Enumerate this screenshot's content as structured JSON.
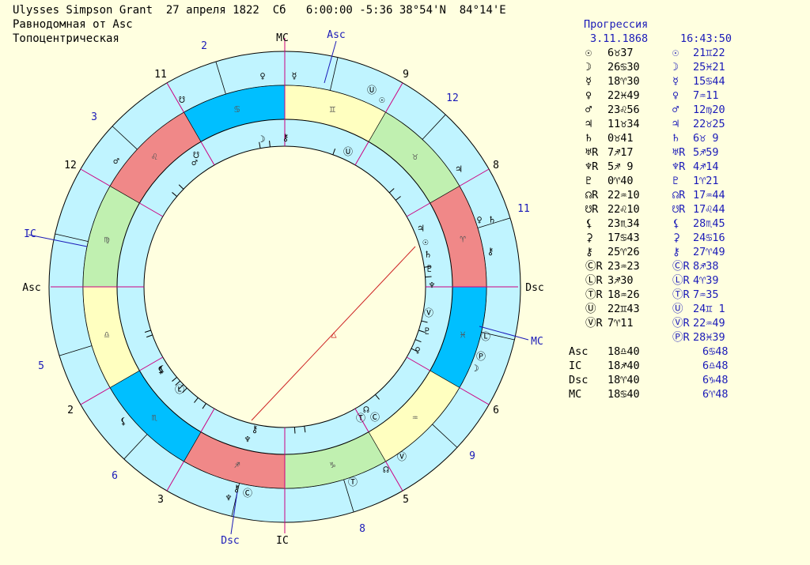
{
  "header": {
    "line1": "Ulysses Simpson Grant  27 апреля 1822  Сб   6:00:00 -5:36 38°54'N  84°14'E",
    "line2": "Равнодомная от Asc",
    "line3": "Топоцентрическая"
  },
  "progression": {
    "title": "Прогрессия",
    "date": "3.11.1868",
    "time": "16:43:50"
  },
  "planets": [
    {
      "glyph": "☉",
      "natal": "6♉37",
      "prog": "21♊22"
    },
    {
      "glyph": "☽",
      "natal": "26♋30",
      "prog": "25♓21"
    },
    {
      "glyph": "☿",
      "natal": "18♈30",
      "prog": "15♋44"
    },
    {
      "glyph": "♀",
      "natal": "22♓49",
      "prog": "7♒11"
    },
    {
      "glyph": "♂",
      "natal": "23♌56",
      "prog": "12♍20"
    },
    {
      "glyph": "♃",
      "natal": "11♉34",
      "prog": "22♉25"
    },
    {
      "glyph": "♄",
      "natal": "0♉41",
      "prog": "6♉ 9"
    },
    {
      "glyph": "♅",
      "r": "R",
      "natal": "7♐17",
      "prog": "5♐59"
    },
    {
      "glyph": "♆",
      "r": "R",
      "natal": "5♐ 9",
      "prog": "4♐14"
    },
    {
      "glyph": "♇",
      "natal": "0♈40",
      "prog": "1♈21"
    },
    {
      "glyph": "☊",
      "r": "R",
      "natal": "22♒10",
      "prog": "17♒44"
    },
    {
      "glyph": "☋",
      "r": "R",
      "natal": "22♌10",
      "prog": "17♌44"
    },
    {
      "glyph": "⚸",
      "natal": "23♏34",
      "prog": "28♏45"
    },
    {
      "glyph": "⚳",
      "natal": "17♋43",
      "prog": "24♋16"
    },
    {
      "glyph": "⚷",
      "natal": "25♈26",
      "prog": "27♈49"
    },
    {
      "glyph": "Ⓒ",
      "r": "R",
      "natal": "23♒23",
      "prog": "8♐38"
    },
    {
      "glyph": "Ⓛ",
      "r": "R",
      "natal": "3♐30",
      "prog": "4♈39"
    },
    {
      "glyph": "Ⓣ",
      "r": "R",
      "natal": "18♒26",
      "prog": "7♒35"
    },
    {
      "glyph": "Ⓤ",
      "natal": "22♊43",
      "prog": "24♊ 1"
    },
    {
      "glyph": "Ⓥ",
      "r": "R",
      "natal": "7♈11",
      "prog": "22♒49"
    },
    {
      "glyph": "Ⓟ",
      "r": "R",
      "natal": "",
      "prog": "28♓39"
    }
  ],
  "angles": [
    {
      "name": "Asc",
      "natal": "18♎40",
      "prog": "6♋48"
    },
    {
      "name": "IC",
      "natal": "18♐40",
      "prog": "6♎48"
    },
    {
      "name": "Dsc",
      "natal": "18♈40",
      "prog": "6♑48"
    },
    {
      "name": "MC",
      "natal": "18♋40",
      "prog": "6♈48"
    }
  ],
  "wheel": {
    "axis_labels": {
      "mc": "MC",
      "ic": "IC",
      "asc": "Asc",
      "dsc": "Dsc"
    },
    "prog_axis_labels": {
      "asc": "Asc",
      "ic": "IC",
      "mc": "MC",
      "dsc": "Dsc"
    },
    "natal_house_numbers": [
      "11",
      "9",
      "8",
      "6",
      "5",
      "3",
      "2",
      "12"
    ],
    "prog_house_numbers": [
      "2",
      "12",
      "3",
      "11",
      "5",
      "9",
      "6",
      "8"
    ],
    "signs": [
      {
        "glyph": "♋",
        "color": "#00bfff"
      },
      {
        "glyph": "♊",
        "color": "#ffffc0"
      },
      {
        "glyph": "♉",
        "color": "#c0f0b0"
      },
      {
        "glyph": "♈",
        "color": "#f08888"
      },
      {
        "glyph": "♓",
        "color": "#00bfff"
      },
      {
        "glyph": "♒",
        "color": "#ffffc0"
      },
      {
        "glyph": "♑",
        "color": "#c0f0b0"
      },
      {
        "glyph": "♐",
        "color": "#f08888"
      },
      {
        "glyph": "♏",
        "color": "#00bfff"
      },
      {
        "glyph": "♎",
        "color": "#ffffc0"
      },
      {
        "glyph": "♍",
        "color": "#c0f0b0"
      },
      {
        "glyph": "♌",
        "color": "#f08888"
      }
    ],
    "outer_glyphs": [
      "♀",
      "☿",
      "Ⓤ",
      "☉",
      "♃",
      "♀",
      "♄",
      "⚷",
      "Ⓛ",
      "Ⓟ",
      "☽",
      "Ⓥ",
      "☊",
      "Ⓣ",
      "♆",
      "⚷",
      "Ⓒ",
      "⚸",
      "⚸",
      "☋",
      "♂"
    ],
    "inner_glyphs": [
      "☽",
      "⚷",
      "Ⓤ",
      "♃",
      "☉",
      "♄",
      "♇",
      "♆",
      "Ⓥ",
      "♇",
      "♀",
      "☊",
      "Ⓣ",
      "Ⓒ",
      "♆",
      "⚷",
      "⚸",
      "Ⓛ",
      "♂",
      "☋"
    ],
    "aspect_symbol": "△",
    "colors": {
      "ring": "#c0f4ff",
      "house_line": "#cc0080",
      "axis_line": "#cc0080",
      "prog_axis": "#1a1ab8",
      "aspect": "#cc2020"
    }
  }
}
